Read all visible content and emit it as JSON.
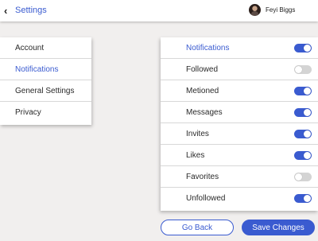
{
  "header": {
    "back_glyph": "‹",
    "title": "Settings",
    "user_name": "Feyi Biggs"
  },
  "menu": {
    "items": [
      {
        "label": "Account"
      },
      {
        "label": "Notifications",
        "active": true
      },
      {
        "label": "General Settings"
      },
      {
        "label": "Privacy"
      }
    ]
  },
  "notifications": {
    "title": "Notifications",
    "master_toggle": true,
    "items": [
      {
        "label": "Followed",
        "enabled": false
      },
      {
        "label": "Metioned",
        "enabled": true
      },
      {
        "label": "Messages",
        "enabled": true
      },
      {
        "label": "Invites",
        "enabled": true
      },
      {
        "label": "Likes",
        "enabled": true
      },
      {
        "label": "Favorites",
        "enabled": false
      },
      {
        "label": "Unfollowed",
        "enabled": true
      }
    ]
  },
  "actions": {
    "go_back_label": "Go Back",
    "save_label": "Save Changes"
  },
  "colors": {
    "accent": "#3a5bd0",
    "toggle_off": "#d4d4d4",
    "background": "#f1efee"
  },
  "icons": {
    "back": "chevron-left-icon",
    "avatar": "user-avatar"
  }
}
